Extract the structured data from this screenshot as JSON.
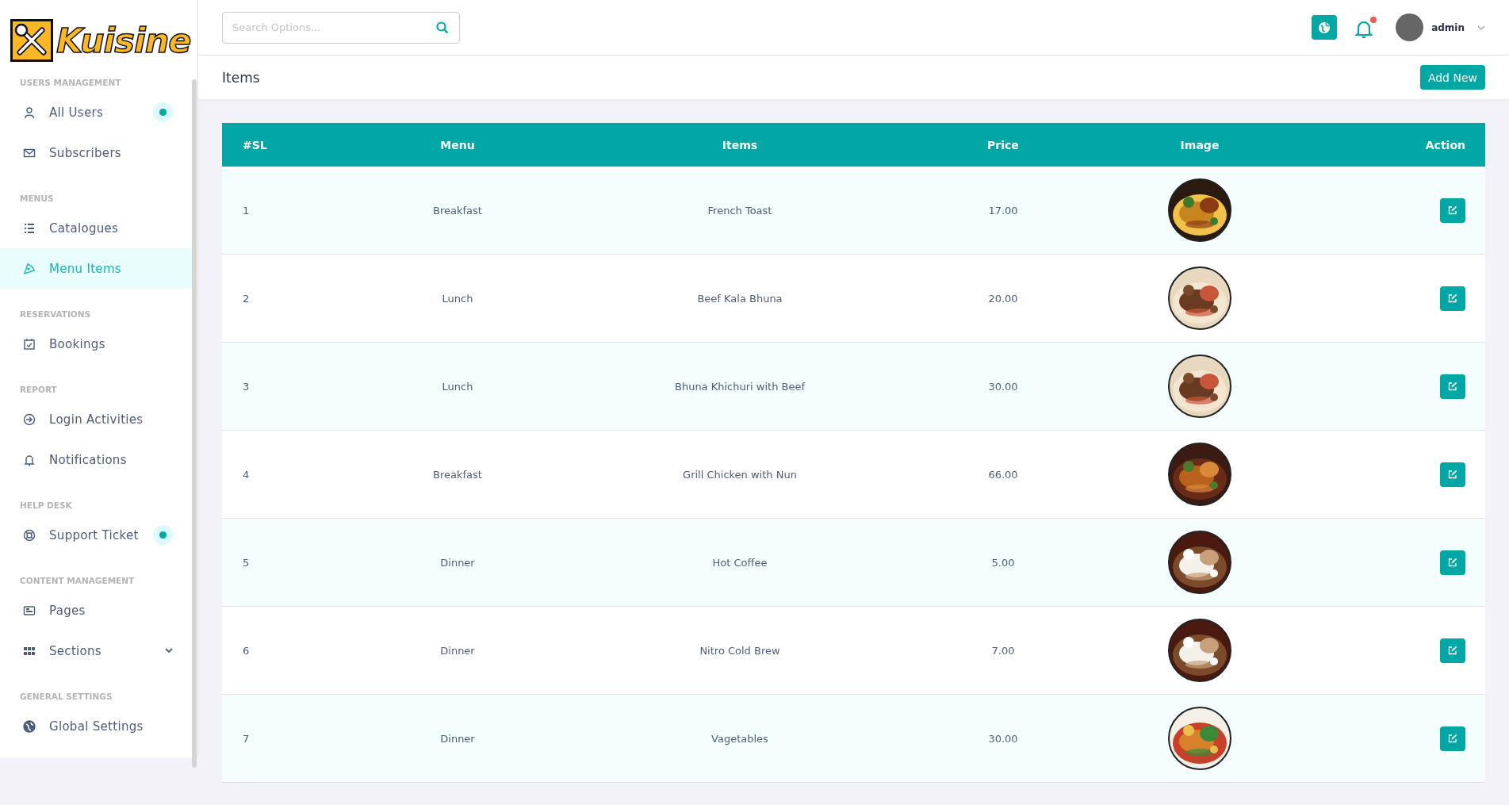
{
  "brand": {
    "name": "Kuisine"
  },
  "sidebar": {
    "sections": [
      {
        "heading": "USERS MANAGEMENT",
        "items": [
          {
            "label": "All Users",
            "selected": false,
            "badge": true,
            "has_submenu": false
          },
          {
            "label": "Subscribers",
            "selected": false,
            "badge": false,
            "has_submenu": false
          }
        ]
      },
      {
        "heading": "MENUS",
        "items": [
          {
            "label": "Catalogues",
            "selected": false,
            "badge": false,
            "has_submenu": false
          },
          {
            "label": "Menu Items",
            "selected": true,
            "badge": false,
            "has_submenu": false
          }
        ]
      },
      {
        "heading": "RESERVATIONS",
        "items": [
          {
            "label": "Bookings",
            "selected": false,
            "badge": false,
            "has_submenu": false
          }
        ]
      },
      {
        "heading": "REPORT",
        "items": [
          {
            "label": "Login Activities",
            "selected": false,
            "badge": false,
            "has_submenu": false
          },
          {
            "label": "Notifications",
            "selected": false,
            "badge": false,
            "has_submenu": false
          }
        ]
      },
      {
        "heading": "HELP DESK",
        "items": [
          {
            "label": "Support Ticket",
            "selected": false,
            "badge": true,
            "has_submenu": false
          }
        ]
      },
      {
        "heading": "CONTENT MANAGEMENT",
        "items": [
          {
            "label": "Pages",
            "selected": false,
            "badge": false,
            "has_submenu": false
          },
          {
            "label": "Sections",
            "selected": false,
            "badge": false,
            "has_submenu": true
          }
        ]
      },
      {
        "heading": "GENERAL SETTINGS",
        "items": [
          {
            "label": "Global Settings",
            "selected": false,
            "badge": false,
            "has_submenu": false
          }
        ]
      }
    ]
  },
  "topbar": {
    "search": {
      "placeholder": "Search Options..."
    },
    "notifications_unread": true,
    "user": {
      "name": "admin"
    }
  },
  "page": {
    "title": "Items",
    "add_button": "Add New"
  },
  "table": {
    "columns": [
      "#SL",
      "Menu",
      "Items",
      "Price",
      "Image",
      "Action"
    ],
    "rows": [
      {
        "sl": "1",
        "menu": "Breakfast",
        "item": "French Toast",
        "price": "17.00"
      },
      {
        "sl": "2",
        "menu": "Lunch",
        "item": "Beef Kala Bhuna",
        "price": "20.00"
      },
      {
        "sl": "3",
        "menu": "Lunch",
        "item": "Bhuna Khichuri with Beef",
        "price": "30.00"
      },
      {
        "sl": "4",
        "menu": "Breakfast",
        "item": "Grill Chicken with Nun",
        "price": "66.00"
      },
      {
        "sl": "5",
        "menu": "Dinner",
        "item": "Hot Coffee",
        "price": "5.00"
      },
      {
        "sl": "6",
        "menu": "Dinner",
        "item": "Nitro Cold Brew",
        "price": "7.00"
      },
      {
        "sl": "7",
        "menu": "Dinner",
        "item": "Vagetables",
        "price": "30.00"
      }
    ]
  }
}
